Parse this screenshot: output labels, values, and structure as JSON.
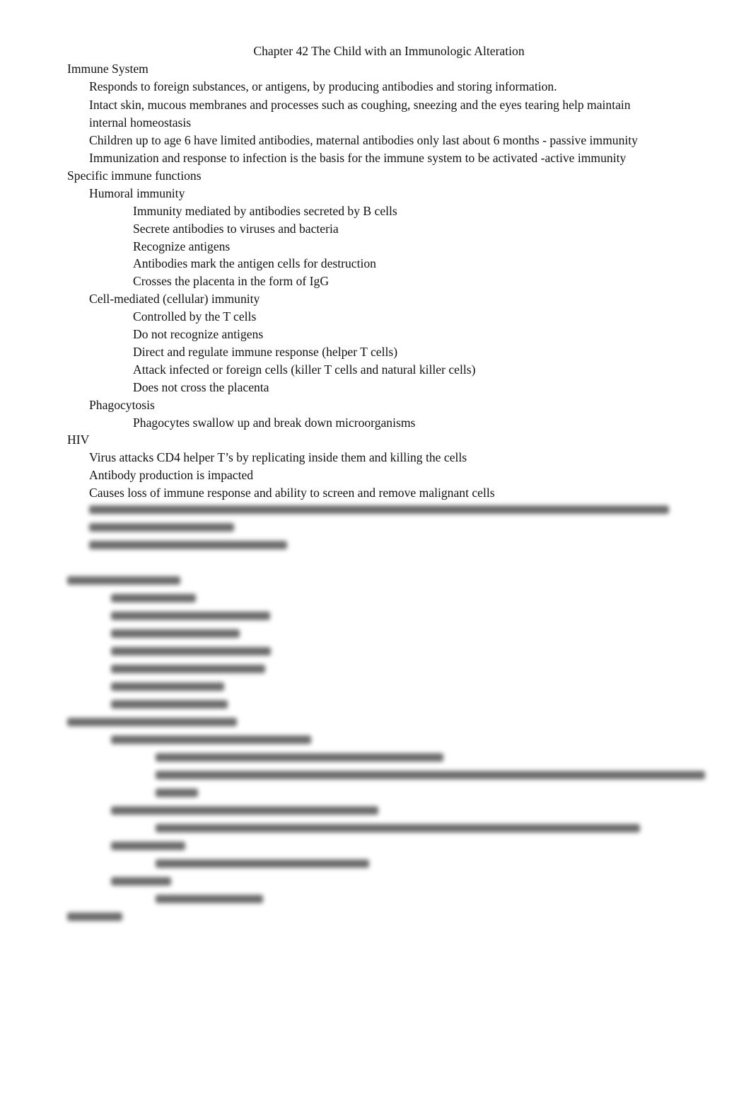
{
  "document": {
    "title": "Chapter 42  The Child with an Immunologic Alteration",
    "sections": [
      {
        "heading": "Immune System",
        "items": [
          "Responds to foreign substances, or antigens, by producing antibodies and storing information.",
          "Intact skin, mucous membranes and processes such as coughing, sneezing and the eyes tearing help maintain",
          "internal homeostasis",
          "Children up to age 6 have limited antibodies, maternal antibodies only last about 6 months - passive immunity",
          "Immunization and response to infection is the basis for the immune system to be activated -active immunity"
        ]
      },
      {
        "heading": "Specific immune functions",
        "subsections": [
          {
            "heading": "Humoral immunity",
            "items": [
              "Immunity mediated by antibodies secreted by B cells",
              "Secrete antibodies to viruses and bacteria",
              "Recognize antigens",
              "Antibodies mark the antigen cells for destruction",
              "Crosses the placenta in the form of IgG"
            ]
          },
          {
            "heading": "Cell-mediated (cellular) immunity",
            "items": [
              "Controlled by the T cells",
              "Do not recognize antigens",
              "Direct and regulate immune response (helper T cells)",
              "Attack infected or foreign cells (killer T cells and natural killer cells)",
              "Does not cross the placenta"
            ]
          },
          {
            "heading": "Phagocytosis",
            "items": [
              "Phagocytes swallow up and break down microorganisms"
            ]
          }
        ]
      },
      {
        "heading": "HIV",
        "items": [
          "Virus attacks CD4 helper T’s by replicating inside them and killing the cells",
          "Antibody production is impacted",
          "Causes loss of immune response and ability to screen and remove malignant cells"
        ]
      }
    ],
    "blurred_region": {
      "state": "obscured",
      "note": "Remaining content is blurred and unreadable"
    }
  }
}
